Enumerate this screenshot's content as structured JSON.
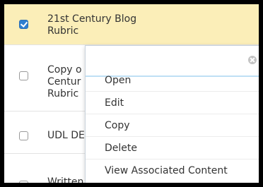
{
  "list": {
    "rows": [
      {
        "label": "21st Century Blog\nRubric",
        "checked": true
      },
      {
        "label": "Copy o\nCentur\nRubric",
        "checked": false
      },
      {
        "label": "UDL DE",
        "checked": false
      },
      {
        "label": "Written",
        "checked": false
      }
    ]
  },
  "context_menu": {
    "items": [
      "Open",
      "Edit",
      "Copy",
      "Delete",
      "View Associated Content"
    ]
  }
}
